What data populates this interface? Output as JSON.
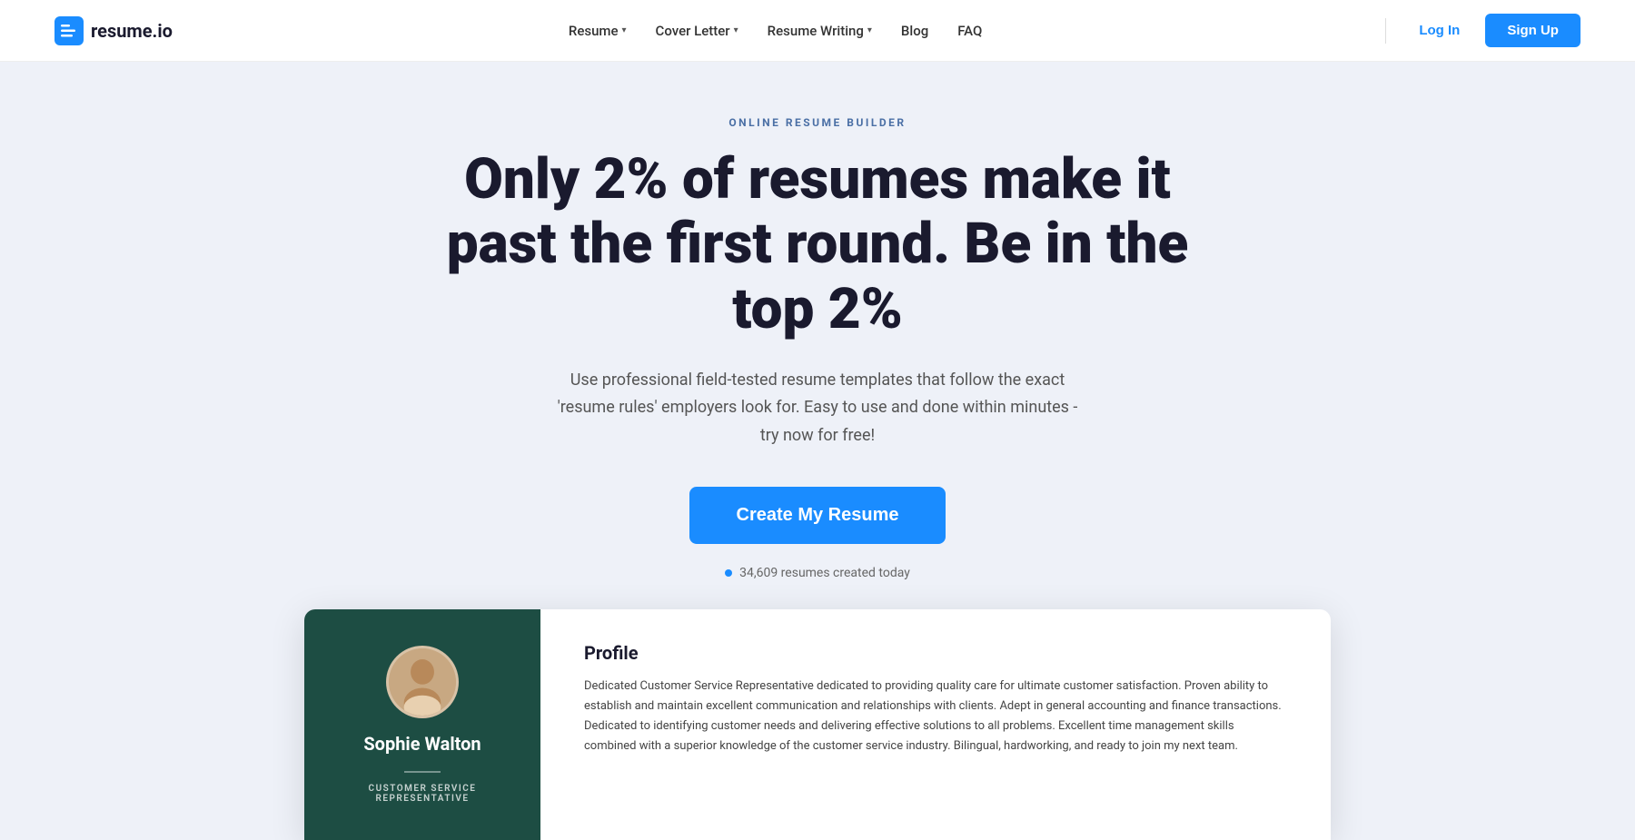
{
  "brand": {
    "name": "resume.io",
    "logo_alt": "Resume.io logo"
  },
  "navbar": {
    "nav_items": [
      {
        "label": "Resume",
        "has_dropdown": true
      },
      {
        "label": "Cover Letter",
        "has_dropdown": true
      },
      {
        "label": "Resume Writing",
        "has_dropdown": true
      },
      {
        "label": "Blog",
        "has_dropdown": false
      },
      {
        "label": "FAQ",
        "has_dropdown": false
      }
    ],
    "login_label": "Log In",
    "signup_label": "Sign Up"
  },
  "hero": {
    "eyebrow": "ONLINE RESUME BUILDER",
    "title": "Only 2% of resumes make it past the first round. Be in the top 2%",
    "subtitle": "Use professional field-tested resume templates that follow the exact 'resume rules' employers look for. Easy to use and done within minutes - try now for free!",
    "cta_label": "Create My Resume",
    "resumes_count": "34,609 resumes created today"
  },
  "resume_card": {
    "person_name": "Sophie Walton",
    "person_title": "CUSTOMER SERVICE\nREPRESENTATIVE",
    "section_title": "Profile",
    "section_text": "Dedicated Customer Service Representative dedicated to providing quality care for ultimate customer satisfaction. Proven ability to establish and maintain excellent communication and relationships with clients. Adept in general accounting and finance transactions. Dedicated to identifying customer needs and delivering effective solutions to all problems. Excellent time management skills combined with a superior knowledge of the customer service industry. Bilingual, hardworking, and ready to join my next team."
  },
  "colors": {
    "accent": "#1a8cff",
    "resume_bg": "#1d4d43",
    "hero_bg": "#eef1f8",
    "dark_text": "#1a1a2e"
  }
}
